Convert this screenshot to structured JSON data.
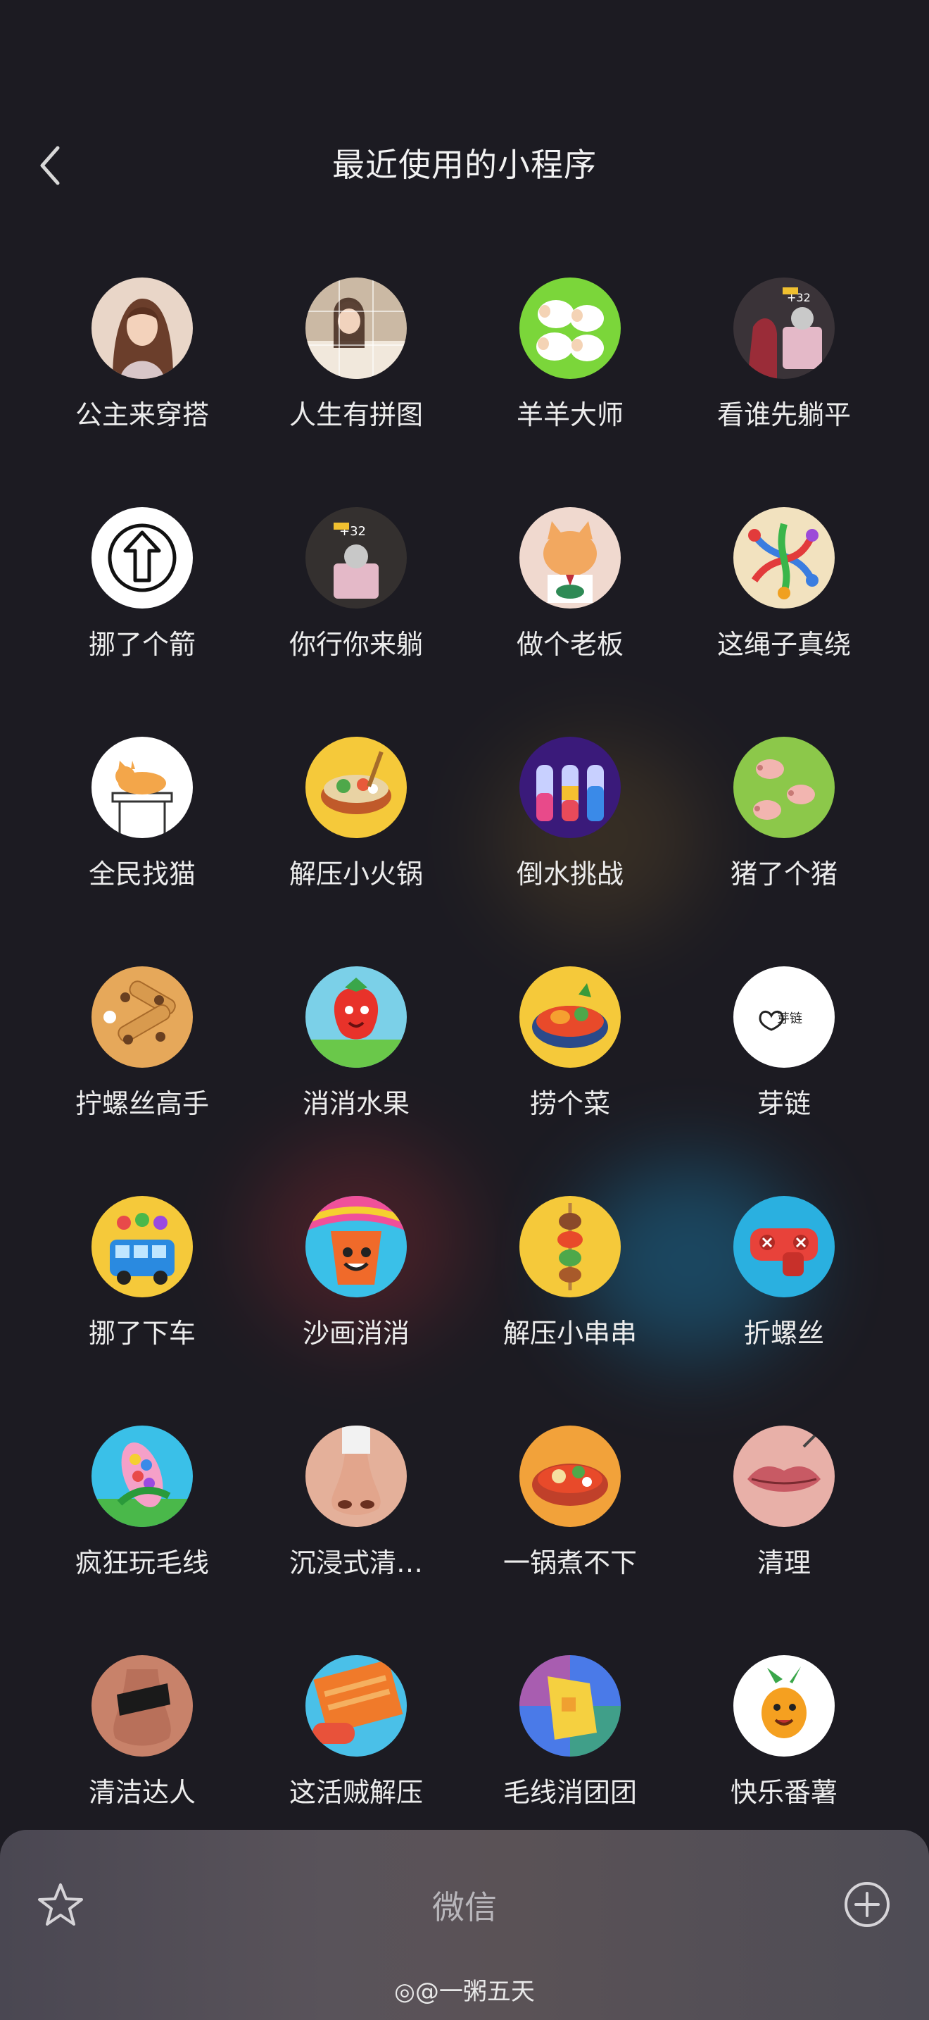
{
  "header": {
    "title": "最近使用的小程序"
  },
  "apps": [
    [
      {
        "label": "公主来穿搭",
        "icon": "princess-dress-icon"
      },
      {
        "label": "人生有拼图",
        "icon": "life-puzzle-icon"
      },
      {
        "label": "羊羊大师",
        "icon": "sheep-master-icon"
      },
      {
        "label": "看谁先躺平",
        "icon": "who-lies-flat-icon"
      }
    ],
    [
      {
        "label": "挪了个箭",
        "icon": "arrow-icon"
      },
      {
        "label": "你行你来躺",
        "icon": "you-lie-icon"
      },
      {
        "label": "做个老板",
        "icon": "cat-boss-icon"
      },
      {
        "label": "这绳子真绕",
        "icon": "rope-icon"
      }
    ],
    [
      {
        "label": "全民找猫",
        "icon": "find-cat-icon"
      },
      {
        "label": "解压小火锅",
        "icon": "hotpot-icon"
      },
      {
        "label": "倒水挑战",
        "icon": "water-bottles-icon"
      },
      {
        "label": "猪了个猪",
        "icon": "pigs-icon"
      }
    ],
    [
      {
        "label": "拧螺丝高手",
        "icon": "screw-board-icon"
      },
      {
        "label": "消消水果",
        "icon": "strawberry-icon"
      },
      {
        "label": "捞个菜",
        "icon": "pot-dish-icon"
      },
      {
        "label": "芽链",
        "icon": "sprout-chain-logo-icon"
      }
    ],
    [
      {
        "label": "挪了下车",
        "icon": "bus-icon"
      },
      {
        "label": "沙画消消",
        "icon": "sand-cup-icon"
      },
      {
        "label": "解压小串串",
        "icon": "skewer-icon"
      },
      {
        "label": "折螺丝",
        "icon": "red-screw-icon"
      }
    ],
    [
      {
        "label": "疯狂玩毛线",
        "icon": "yarn-corn-icon"
      },
      {
        "label": "沉浸式清…",
        "icon": "nose-clean-icon"
      },
      {
        "label": "一锅煮不下",
        "icon": "big-pot-icon"
      },
      {
        "label": "清理",
        "icon": "lips-icon"
      }
    ],
    [
      {
        "label": "清洁达人",
        "icon": "nose-strip-icon"
      },
      {
        "label": "这活贼解压",
        "icon": "knit-roller-icon"
      },
      {
        "label": "毛线消团团",
        "icon": "pixel-yarn-icon"
      },
      {
        "label": "快乐番薯",
        "icon": "happy-potato-icon"
      }
    ]
  ],
  "dock": {
    "title": "微信"
  },
  "watermark": "@一粥五天",
  "logo_text": "芽链"
}
